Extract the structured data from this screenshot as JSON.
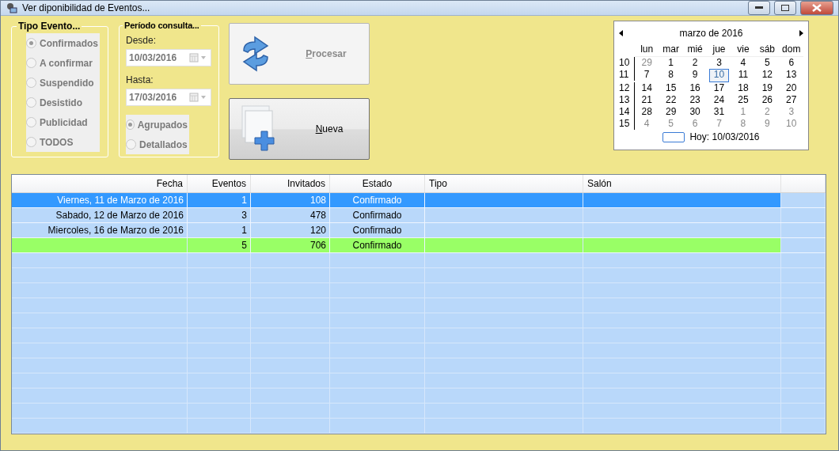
{
  "window": {
    "title": "Ver diponibilidad de Eventos..."
  },
  "tipo_evento": {
    "title": "Tipo Evento...",
    "options": [
      {
        "label": "Confirmados",
        "selected": true
      },
      {
        "label": "A confirmar",
        "selected": false
      },
      {
        "label": "Suspendido",
        "selected": false
      },
      {
        "label": "Desistido",
        "selected": false
      },
      {
        "label": "Publicidad",
        "selected": false
      },
      {
        "label": "TODOS",
        "selected": false
      }
    ]
  },
  "periodo": {
    "title": "Período consulta...",
    "desde": {
      "label": "Desde:",
      "value": "10/03/2016"
    },
    "hasta": {
      "label": "Hasta:",
      "value": "17/03/2016"
    },
    "options": [
      {
        "label": "Agrupados",
        "selected": true
      },
      {
        "label": "Detallados",
        "selected": false
      }
    ]
  },
  "buttons": [
    {
      "kind": "procesar",
      "label": "Procesar",
      "disabled": true
    },
    {
      "kind": "nueva",
      "label": "Nueva",
      "disabled": false
    }
  ],
  "calendar": {
    "title": "marzo de 2016",
    "weekdays": [
      "lun",
      "mar",
      "mié",
      "jue",
      "vie",
      "sáb",
      "dom"
    ],
    "weeks": [
      {
        "number": "10",
        "days": [
          {
            "label": "29",
            "other": true,
            "selected": false
          },
          {
            "label": "1",
            "other": false,
            "selected": false
          },
          {
            "label": "2",
            "other": false,
            "selected": false
          },
          {
            "label": "3",
            "other": false,
            "selected": false
          },
          {
            "label": "4",
            "other": false,
            "selected": false
          },
          {
            "label": "5",
            "other": false,
            "selected": false
          },
          {
            "label": "6",
            "other": false,
            "selected": false
          }
        ]
      },
      {
        "number": "11",
        "days": [
          {
            "label": "7",
            "other": false,
            "selected": false
          },
          {
            "label": "8",
            "other": false,
            "selected": false
          },
          {
            "label": "9",
            "other": false,
            "selected": false
          },
          {
            "label": "10",
            "other": false,
            "selected": true
          },
          {
            "label": "11",
            "other": false,
            "selected": false
          },
          {
            "label": "12",
            "other": false,
            "selected": false
          },
          {
            "label": "13",
            "other": false,
            "selected": false
          }
        ]
      },
      {
        "number": "12",
        "days": [
          {
            "label": "14",
            "other": false,
            "selected": false
          },
          {
            "label": "15",
            "other": false,
            "selected": false
          },
          {
            "label": "16",
            "other": false,
            "selected": false
          },
          {
            "label": "17",
            "other": false,
            "selected": false
          },
          {
            "label": "18",
            "other": false,
            "selected": false
          },
          {
            "label": "19",
            "other": false,
            "selected": false
          },
          {
            "label": "20",
            "other": false,
            "selected": false
          }
        ]
      },
      {
        "number": "13",
        "days": [
          {
            "label": "21",
            "other": false,
            "selected": false
          },
          {
            "label": "22",
            "other": false,
            "selected": false
          },
          {
            "label": "23",
            "other": false,
            "selected": false
          },
          {
            "label": "24",
            "other": false,
            "selected": false
          },
          {
            "label": "25",
            "other": false,
            "selected": false
          },
          {
            "label": "26",
            "other": false,
            "selected": false
          },
          {
            "label": "27",
            "other": false,
            "selected": false
          }
        ]
      },
      {
        "number": "14",
        "days": [
          {
            "label": "28",
            "other": false,
            "selected": false
          },
          {
            "label": "29",
            "other": false,
            "selected": false
          },
          {
            "label": "30",
            "other": false,
            "selected": false
          },
          {
            "label": "31",
            "other": false,
            "selected": false
          },
          {
            "label": "1",
            "other": true,
            "selected": false
          },
          {
            "label": "2",
            "other": true,
            "selected": false
          },
          {
            "label": "3",
            "other": true,
            "selected": false
          }
        ]
      },
      {
        "number": "15",
        "days": [
          {
            "label": "4",
            "other": true,
            "selected": false
          },
          {
            "label": "5",
            "other": true,
            "selected": false
          },
          {
            "label": "6",
            "other": true,
            "selected": false
          },
          {
            "label": "7",
            "other": true,
            "selected": false
          },
          {
            "label": "8",
            "other": true,
            "selected": false
          },
          {
            "label": "9",
            "other": true,
            "selected": false
          },
          {
            "label": "10",
            "other": true,
            "selected": false
          }
        ]
      }
    ],
    "today": "Hoy: 10/03/2016"
  },
  "table": {
    "columns": [
      "Fecha",
      "Eventos",
      "Invitados",
      "Estado",
      "Tipo",
      "Salón"
    ],
    "rows": [
      {
        "kind": "detail",
        "selected": true,
        "cells": [
          "Viernes, 11 de Marzo de 2016",
          "1",
          "108",
          "Confirmado",
          "",
          ""
        ]
      },
      {
        "kind": "detail",
        "selected": false,
        "cells": [
          "Sabado, 12 de Marzo de 2016",
          "3",
          "478",
          "Confirmado",
          "",
          ""
        ]
      },
      {
        "kind": "detail",
        "selected": false,
        "cells": [
          "Miercoles, 16 de Marzo de 2016",
          "1",
          "120",
          "Confirmado",
          "",
          ""
        ]
      },
      {
        "kind": "total",
        "selected": false,
        "cells": [
          "",
          "5",
          "706",
          "Confirmado",
          "",
          ""
        ]
      }
    ]
  }
}
